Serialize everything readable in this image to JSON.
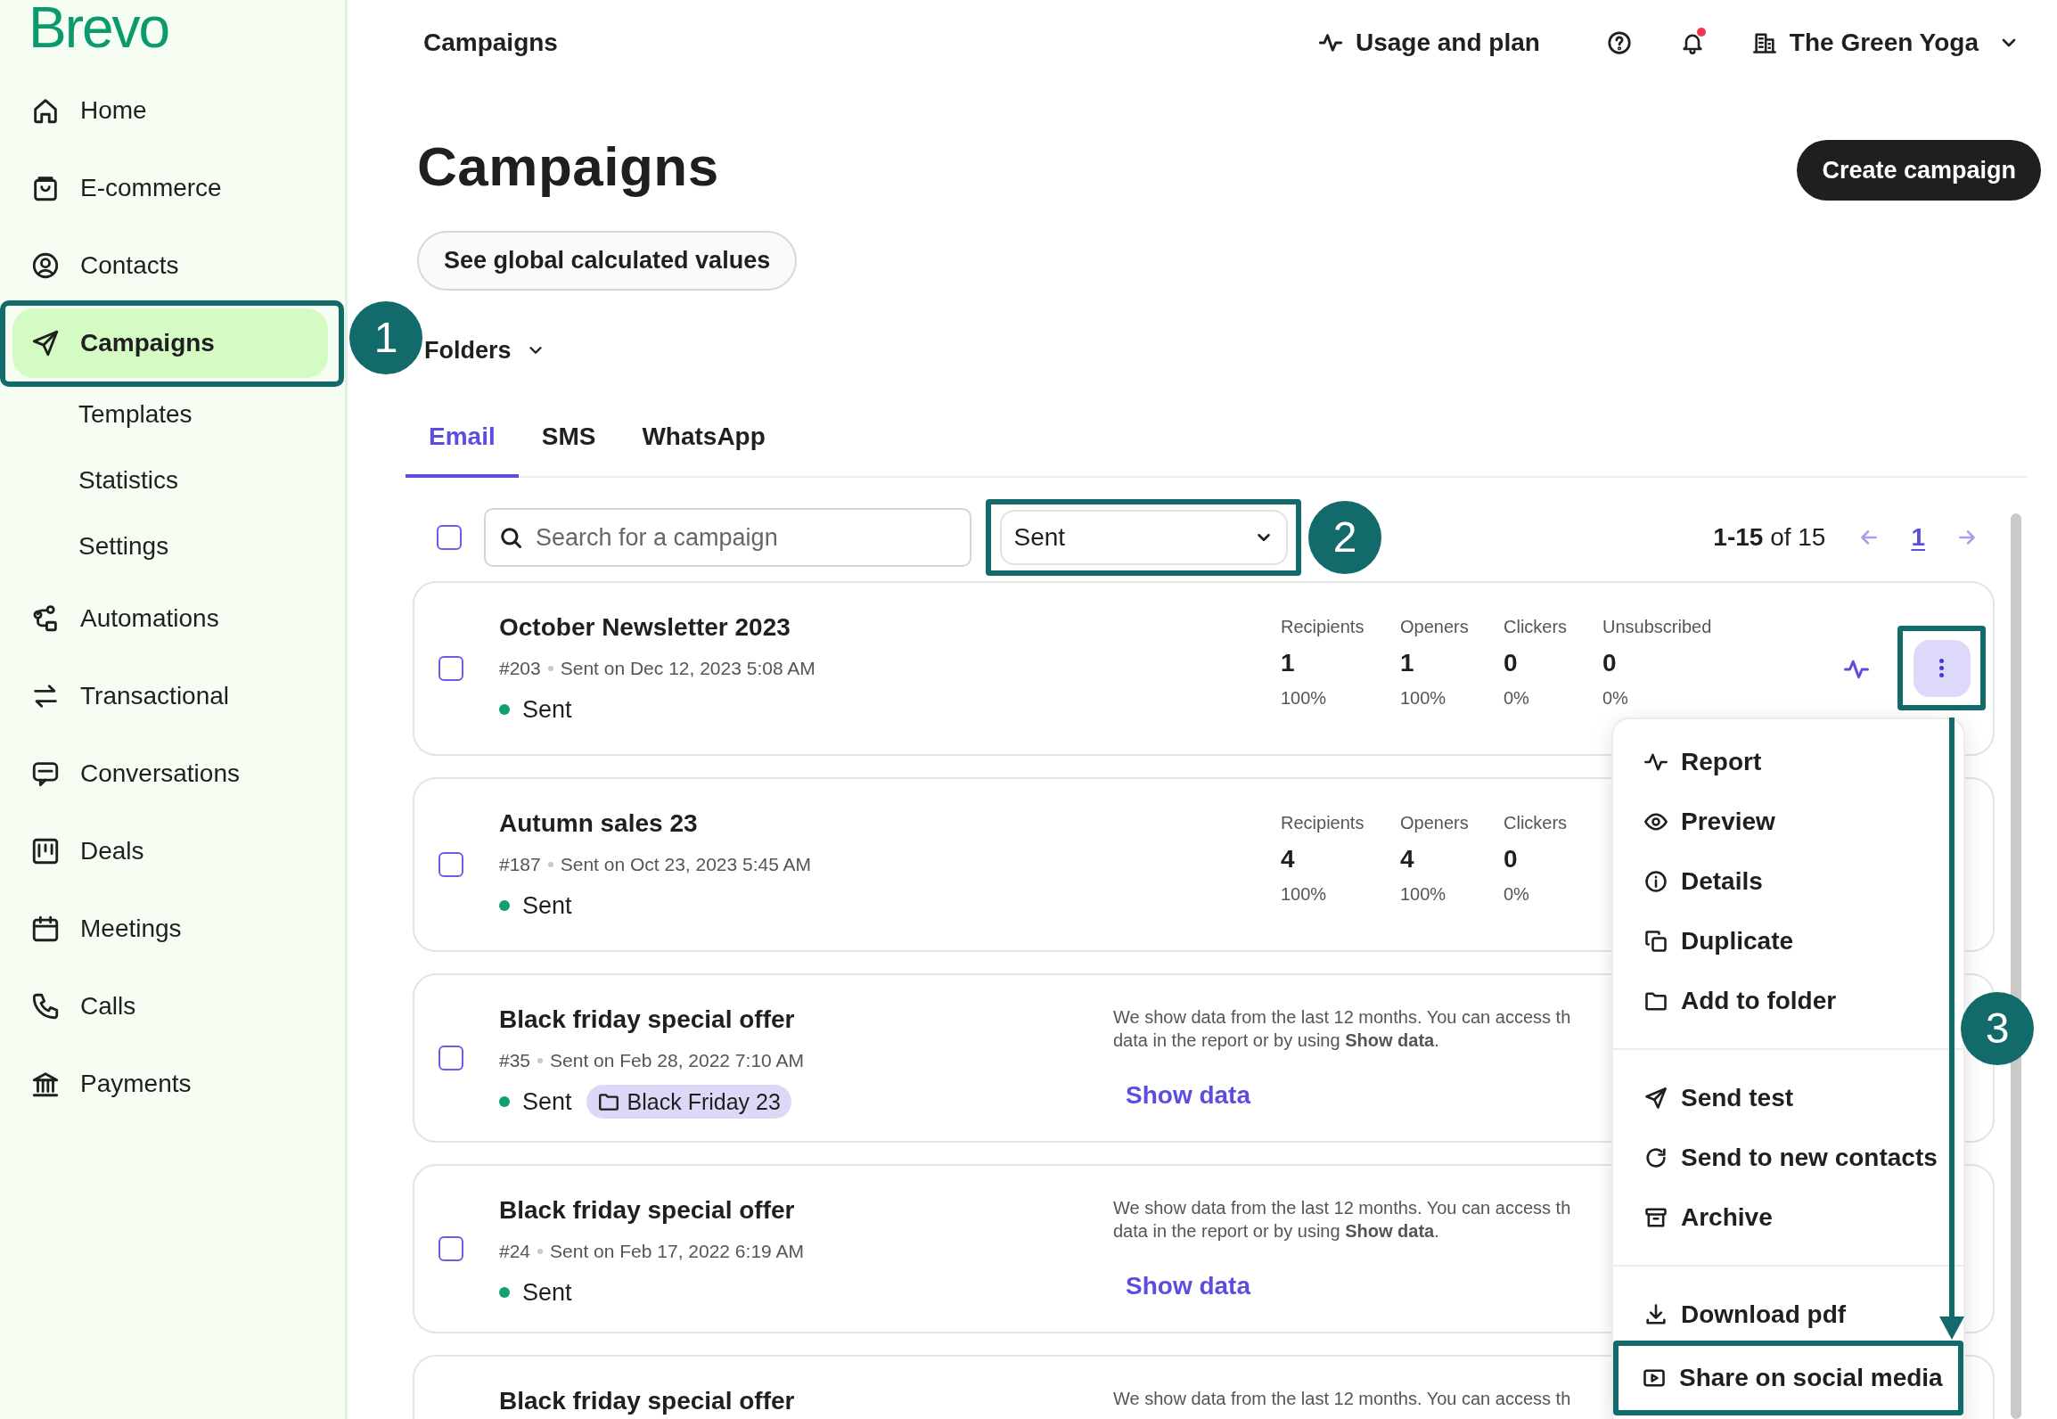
{
  "logo": "Brevo",
  "sidebar": {
    "items": [
      {
        "label": "Home",
        "selected": false
      },
      {
        "label": "E-commerce",
        "selected": false
      },
      {
        "label": "Contacts",
        "selected": false
      },
      {
        "label": "Campaigns",
        "selected": true,
        "children": [
          {
            "label": "Templates",
            "selected": false
          },
          {
            "label": "Statistics",
            "selected": false
          },
          {
            "label": "Settings",
            "selected": false
          }
        ]
      },
      {
        "label": "Automations",
        "selected": false
      },
      {
        "label": "Transactional",
        "selected": false
      },
      {
        "label": "Conversations",
        "selected": false
      },
      {
        "label": "Deals",
        "selected": false
      },
      {
        "label": "Meetings",
        "selected": false
      },
      {
        "label": "Calls",
        "selected": false
      },
      {
        "label": "Payments",
        "selected": false
      }
    ]
  },
  "header": {
    "title": "Campaigns",
    "usage": "Usage and plan",
    "has_notification": true,
    "account": "The Green Yoga"
  },
  "page": {
    "title": "Campaigns",
    "create_button": "Create campaign",
    "global_button": "See global calculated values",
    "folders": "Folders"
  },
  "tabs": [
    {
      "label": "Email",
      "selected": true
    },
    {
      "label": "SMS",
      "selected": false
    },
    {
      "label": "WhatsApp",
      "selected": false
    }
  ],
  "toolbar": {
    "select_all_checked": false,
    "search": {
      "placeholder": "Search for a campaign"
    },
    "filter": "Sent",
    "range": "**1-15** of 15",
    "page": "1"
  },
  "campaigns": [
    {
      "kind": "stats",
      "title": "October Newsletter 2023",
      "checked": false,
      "number": "#203",
      "sent_on": "Sent on Dec 12, 2023 5:08 AM",
      "status": "Sent",
      "stats": [
        {
          "label": "Recipients",
          "value": "1",
          "percent": "100%"
        },
        {
          "label": "Openers",
          "value": "1",
          "percent": "100%"
        },
        {
          "label": "Clickers",
          "value": "0",
          "percent": "0%"
        },
        {
          "label": "Unsubscribed",
          "value": "0",
          "percent": "0%"
        }
      ]
    },
    {
      "kind": "stats",
      "title": "Autumn sales 23",
      "checked": false,
      "number": "#187",
      "sent_on": "Sent on Oct 23, 2023 5:45 AM",
      "status": "Sent",
      "stats": [
        {
          "label": "Recipients",
          "value": "4",
          "percent": "100%"
        },
        {
          "label": "Openers",
          "value": "4",
          "percent": "100%"
        },
        {
          "label": "Clickers",
          "value": "0",
          "percent": "0%"
        }
      ]
    },
    {
      "kind": "note",
      "title": "Black friday special offer",
      "checked": false,
      "number": "#35",
      "sent_on": "Sent on Feb 28, 2022 7:10 AM",
      "status": "Sent",
      "folder": "Black Friday 23",
      "note_lines": [
        "We show data from the last 12 months. You can access th",
        "data in the report or by using **Show data**."
      ],
      "link": "Show data"
    },
    {
      "kind": "note",
      "title": "Black friday special offer",
      "checked": false,
      "number": "#24",
      "sent_on": "Sent on Feb 17, 2022 6:19 AM",
      "status": "Sent",
      "note_lines": [
        "We show data from the last 12 months. You can access th",
        "data in the report or by using **Show data**."
      ],
      "link": "Show data"
    },
    {
      "kind": "note",
      "title": "Black friday special offer",
      "note_lines": [
        "We show data from the last 12 months. You can access th"
      ]
    }
  ],
  "menu": {
    "groups": [
      [
        {
          "label": "Report"
        },
        {
          "label": "Preview"
        },
        {
          "label": "Details"
        },
        {
          "label": "Duplicate"
        },
        {
          "label": "Add to folder"
        }
      ],
      [
        {
          "label": "Send test"
        },
        {
          "label": "Send to new contacts"
        },
        {
          "label": "Archive"
        }
      ],
      [
        {
          "label": "Download pdf"
        },
        {
          "label": "Share on social media"
        }
      ]
    ]
  },
  "annotations": [
    {
      "label": "1"
    },
    {
      "label": "2"
    },
    {
      "label": "3"
    }
  ]
}
